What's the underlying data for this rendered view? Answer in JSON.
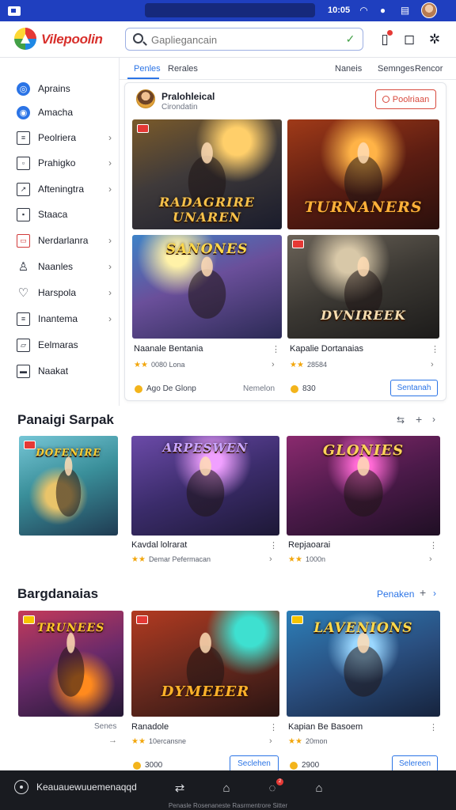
{
  "status_bar": {
    "time": "10:05",
    "accent_color": "#1f3fbf"
  },
  "app": {
    "name": "Vilepoolin"
  },
  "search": {
    "placeholder": "Gapliegancain"
  },
  "sidebar": {
    "items": [
      {
        "label": "Aprains",
        "icon": "compass-icon"
      },
      {
        "label": "Amacha",
        "icon": "globe-icon"
      },
      {
        "label": "Peolriera",
        "icon": "document-icon"
      },
      {
        "label": "Prahigko",
        "icon": "folder-icon"
      },
      {
        "label": "Afteningtra",
        "icon": "chart-icon"
      },
      {
        "label": "Staaca",
        "icon": "square-icon"
      },
      {
        "label": "Nerdarlanra",
        "icon": "window-icon"
      },
      {
        "label": "Naanles",
        "icon": "user-icon"
      },
      {
        "label": "Harspola",
        "icon": "heart-icon"
      },
      {
        "label": "Inantema",
        "icon": "list-icon"
      },
      {
        "label": "Eelmaras",
        "icon": "chat-icon"
      },
      {
        "label": "Naakat",
        "icon": "flag-icon"
      }
    ]
  },
  "tabs": [
    "Penles",
    "Rerales",
    "Naneis",
    "Semnges",
    "Rencor"
  ],
  "featured": {
    "title": "Pralohleical",
    "subtitle": "Cirondatin",
    "follow_label": "Poolriaan",
    "art_titles": [
      "Radagrire Unaren",
      "Turnaners",
      "Sanones",
      "Dvnireek"
    ],
    "games": [
      {
        "name": "Naanale Bentania",
        "rating": "0080 Lona"
      },
      {
        "name": "Kapalie Dortanaias",
        "rating": "28584"
      }
    ],
    "footer_left": "Ago De Glonp",
    "footer_mid": "Nemelon",
    "footer_coin": "830",
    "footer_button": "Sentanah"
  },
  "section1": {
    "title": "Panaigi Sarpak",
    "controls": "+",
    "art_titles": [
      "Dofenire",
      "Arpeswen",
      "Glonies"
    ],
    "games": [
      {
        "name": "Kavdal lolrarat",
        "rating": "Demar Pefermacan"
      },
      {
        "name": "Repjaoarai",
        "rating": "1000n"
      }
    ]
  },
  "section2": {
    "title": "Bargdanaias",
    "link": "Penaken",
    "art_titles": [
      "Trunees",
      "Dymeeer",
      "Lavenions"
    ],
    "side_label": "Senes",
    "games": [
      {
        "name": "Ranadole",
        "rating": "10ercansne",
        "button": "Seclehen"
      },
      {
        "name": "Kapian Be Basoem",
        "rating": "20mon",
        "button": "Selereen"
      }
    ],
    "coins": [
      "3000",
      "2900"
    ]
  },
  "bottom_nav": {
    "first_label": "Keauauewuuemenaqqd",
    "caption": "Penasle Rosenaneste Rasrmentrore Sitter",
    "badge_count": "2"
  }
}
